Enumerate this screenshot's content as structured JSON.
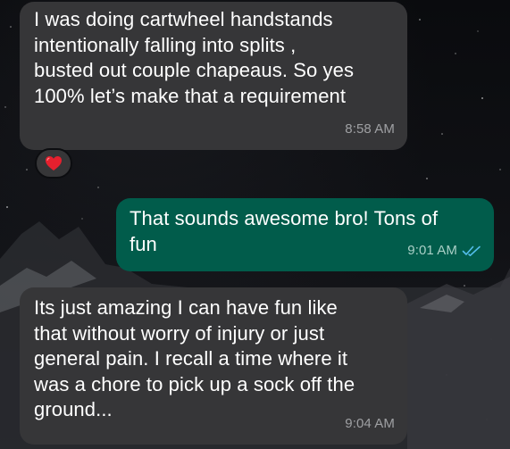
{
  "chat": {
    "messages": [
      {
        "direction": "incoming",
        "text": "I was doing cartwheel handstands\nintentionally falling into splits ,\nbusted out couple chapeaus. So yes\n100% let’s make that a requirement",
        "time": "8:58 AM",
        "reaction": "red-heart"
      },
      {
        "direction": "outgoing",
        "text": "That sounds awesome bro! Tons of\nfun",
        "time": "9:01 AM",
        "status": "read",
        "status_icon": "double-check-icon"
      },
      {
        "direction": "incoming",
        "text": "Its just amazing I can have fun like\nthat without worry of injury or just\ngeneral pain. I recall a time where it\nwas a chore to pick up a sock off the\nground...",
        "time": "9:04 AM"
      }
    ]
  },
  "colors": {
    "incoming_bubble": "#363638",
    "outgoing_bubble": "#015c4b",
    "read_ticks": "#53bdeb",
    "heart": "#e5202e"
  }
}
